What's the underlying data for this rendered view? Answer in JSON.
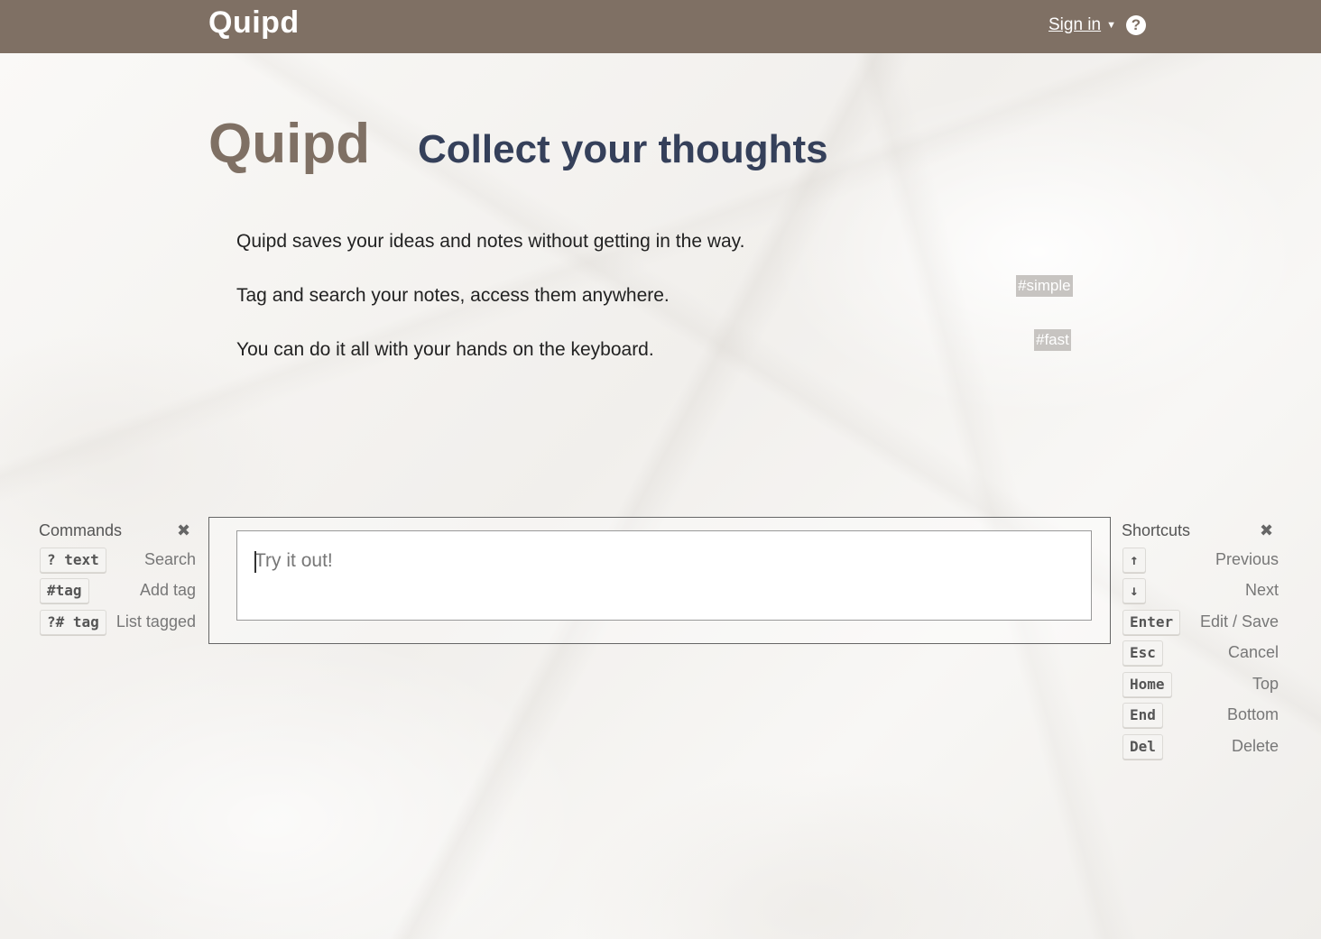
{
  "header": {
    "brand": "Quipd",
    "signin_label": "Sign in",
    "signin_caret": "▼",
    "help_icon": "?"
  },
  "hero": {
    "logo": "Quipd",
    "tagline": "Collect your thoughts"
  },
  "features": [
    "Quipd saves your ideas and notes without getting in the way.",
    "Tag and search your notes, access them anywhere.",
    "You can do it all with your hands on the keyboard."
  ],
  "tags": [
    "#simple",
    "#fast"
  ],
  "commands": {
    "title": "Commands",
    "close_icon": "✖",
    "items": [
      {
        "key": "? text",
        "label": "Search"
      },
      {
        "key": "#tag",
        "label": "Add tag"
      },
      {
        "key": "?# tag",
        "label": "List tagged"
      }
    ]
  },
  "editor": {
    "placeholder": "Try it out!"
  },
  "shortcuts": {
    "title": "Shortcuts",
    "close_icon": "✖",
    "items": [
      {
        "key": "↑",
        "label": "Previous"
      },
      {
        "key": "↓",
        "label": "Next"
      },
      {
        "key": "Enter",
        "label": "Edit / Save"
      },
      {
        "key": "Esc",
        "label": "Cancel"
      },
      {
        "key": "Home",
        "label": "Top"
      },
      {
        "key": "End",
        "label": "Bottom"
      },
      {
        "key": "Del",
        "label": "Delete"
      }
    ]
  },
  "colors": {
    "header_bg": "#7f7064",
    "tagline": "#35405a",
    "tag_badge": "#c7c4c1"
  }
}
